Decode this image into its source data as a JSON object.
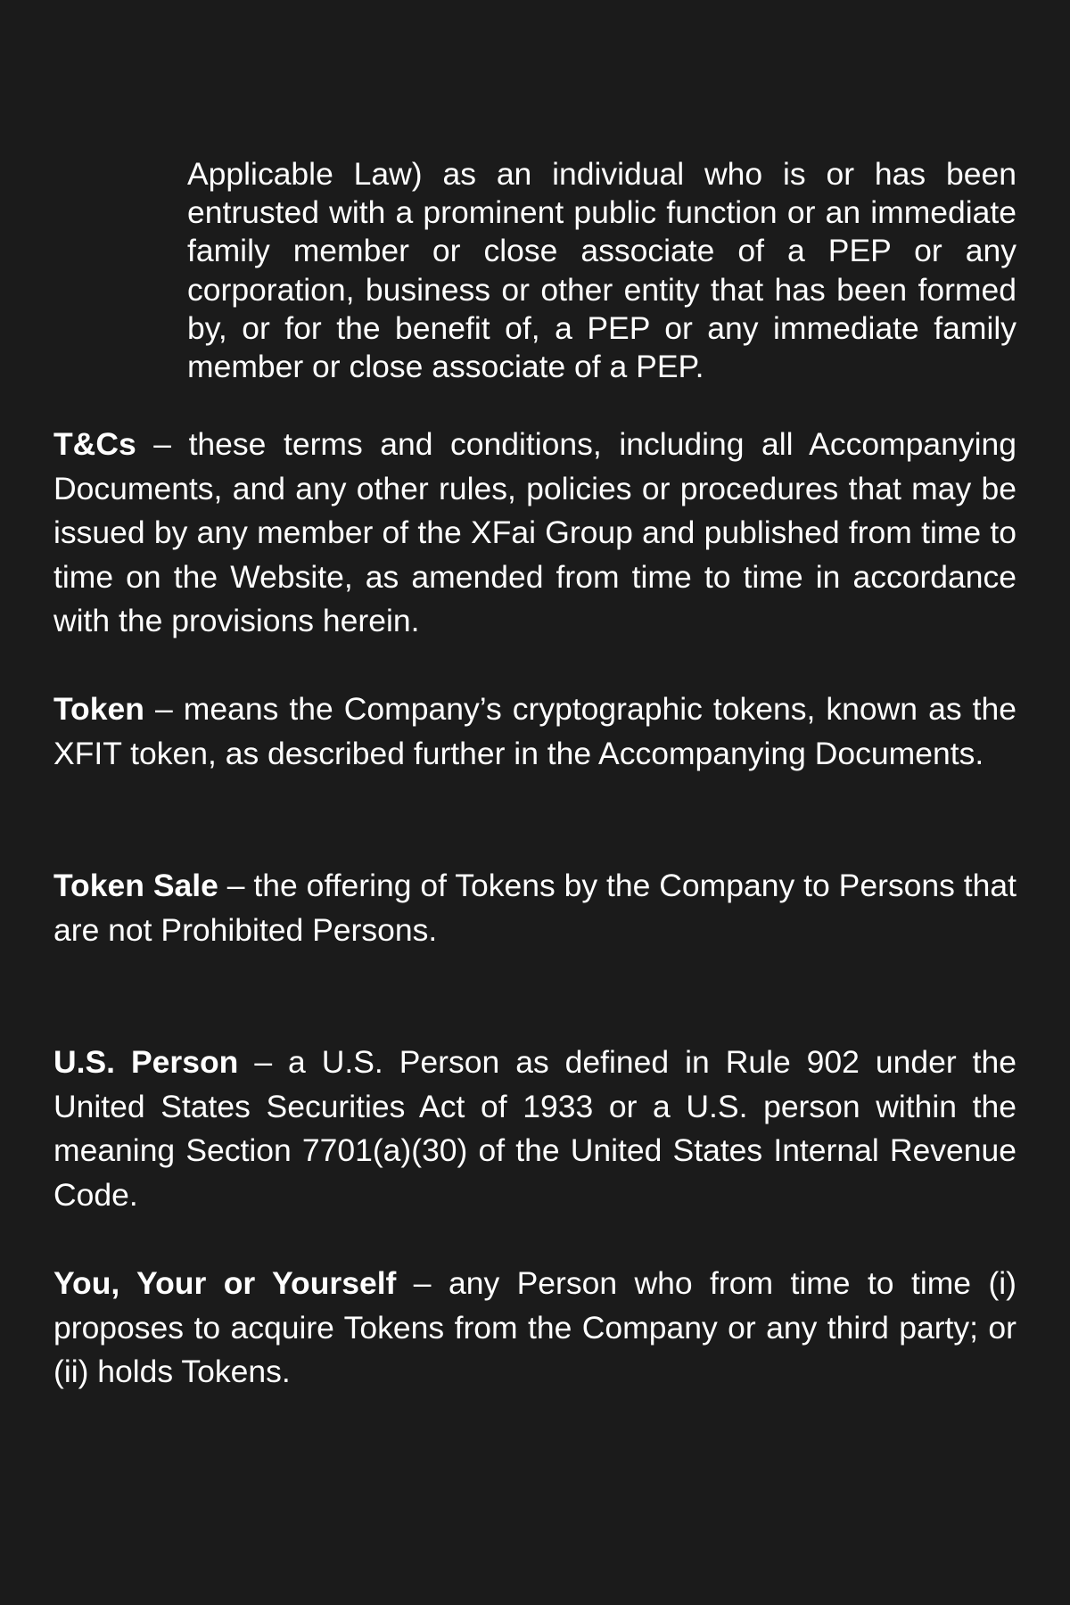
{
  "continuation": {
    "text": "Applicable Law) as an individual who is or has been entrusted with a prominent public function or an immediate family member or close associate of a PEP or any corporation, business or other entity that has been formed by, or for the benefit of, a PEP or any immediate family member or close associate of a PEP."
  },
  "definitions": [
    {
      "term": "T&Cs",
      "text": " – these terms and conditions, including all Accompanying Documents, and any other rules, policies or procedures that may be issued by any member of the XFai Group and published from time to time on the Website, as amended from time to time in accordance with the provisions herein."
    },
    {
      "term": "Token",
      "text": " – means the Company’s cryptographic tokens, known as the XFIT token, as described further in the Accompanying Documents."
    },
    {
      "term": "Token Sale",
      "text": " – the offering of Tokens by the Company to Persons that are not Prohibited Persons."
    },
    {
      "term": "U.S. Person",
      "text": " – a U.S. Person as defined in Rule 902 under the United States Securities Act of 1933 or a U.S. person within the meaning Section 7701(a)(30) of the United States Internal Revenue Code."
    },
    {
      "term": "You, Your or Yourself",
      "text": " – any Person who from time to time (i) proposes to acquire Tokens from the Company or any third party; or (ii) holds Tokens."
    }
  ]
}
